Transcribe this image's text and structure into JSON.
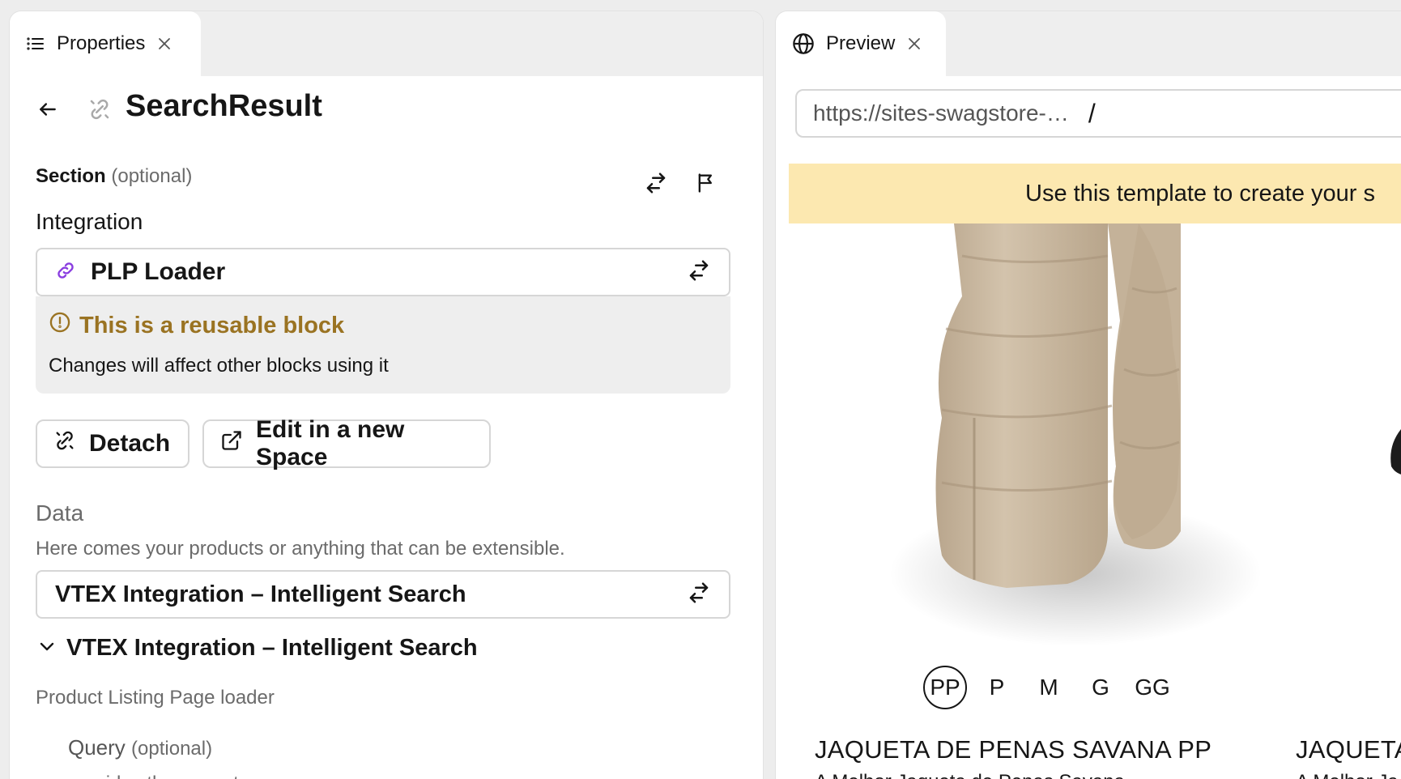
{
  "properties_panel": {
    "tab_label": "Properties",
    "title": "SearchResult",
    "section_label": "Section",
    "section_optional": "(optional)",
    "integration_label": "Integration",
    "integration_value": "PLP Loader",
    "reusable_title": "This is a reusable block",
    "reusable_desc": "Changes will affect other blocks using it",
    "detach_label": "Detach",
    "edit_space_label": "Edit in a new Space",
    "data_label": "Data",
    "data_desc": "Here comes your products or anything that can be extensible.",
    "data_value": "VTEX Integration – Intelligent Search",
    "expand_label": "VTEX Integration – Intelligent Search",
    "loader_desc": "Product Listing Page loader",
    "query_label": "Query",
    "query_optional": "(optional)",
    "query_desc": "overides the query term"
  },
  "preview_panel": {
    "tab_label": "Preview",
    "url": "https://sites-swagstore-…",
    "path": "/",
    "banner_text": "Use this template to create your s",
    "sizes": [
      "PP",
      "P",
      "M",
      "G",
      "GG"
    ],
    "selected_size": "PP",
    "products": [
      {
        "name": "JAQUETA DE PENAS SAVANA PP",
        "desc": "A Melhor Jaqueta de Penas Savana"
      },
      {
        "name": "JAQUETA",
        "desc": "A Melhor Ja"
      }
    ]
  },
  "colors": {
    "accent_purple": "#8a3ee0",
    "warning_brown": "#9a7322",
    "banner_yellow": "#fce8b0",
    "jacket_beige": "#cdbba3"
  }
}
